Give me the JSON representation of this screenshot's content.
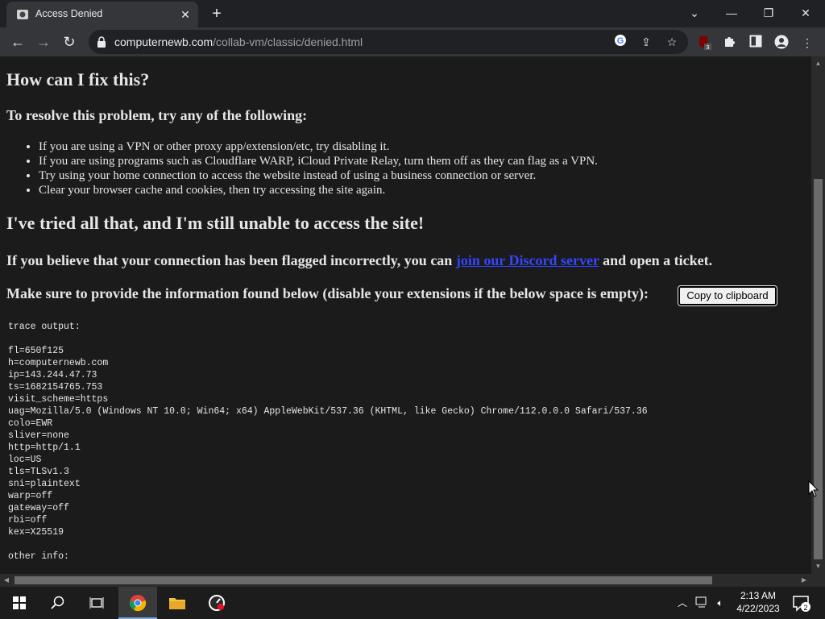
{
  "browser": {
    "tab_title": "Access Denied",
    "url_host": "computernewb.com",
    "url_path": "/collab-vm/classic/denied.html",
    "extension_badge": "3"
  },
  "page": {
    "fix_heading": "How can I fix this?",
    "resolve_heading": "To resolve this problem, try any of the following:",
    "tips": [
      "If you are using a VPN or other proxy app/extension/etc, try disabling it.",
      "If you are using programs such as Cloudflare WARP, iCloud Private Relay, turn them off as they can flag as a VPN.",
      "Try using your home connection to access the website instead of using a business connection or server.",
      "Clear your browser cache and cookies, then try accessing the site again."
    ],
    "still_heading": "I've tried all that, and I'm still unable to access the site!",
    "flagged_prefix": "If you believe that your connection has been flagged incorrectly, you can",
    "flagged_link": "join our Discord server",
    "flagged_suffix": "and open a ticket.",
    "provide_info": "Make sure to provide the information found below (disable your extensions if the below space is empty):",
    "copy_button": "Copy to clipboard",
    "trace_lines": [
      "trace output:",
      "",
      "fl=650f125",
      "h=computernewb.com",
      "ip=143.244.47.73",
      "ts=1682154765.753",
      "visit_scheme=https",
      "uag=Mozilla/5.0 (Windows NT 10.0; Win64; x64) AppleWebKit/537.36 (KHTML, like Gecko) Chrome/112.0.0.0 Safari/537.36",
      "colo=EWR",
      "sliver=none",
      "http=http/1.1",
      "loc=US",
      "tls=TLSv1.3",
      "sni=plaintext",
      "warp=off",
      "gateway=off",
      "rbi=off",
      "kex=X25519",
      "",
      "other info:"
    ]
  },
  "taskbar": {
    "time": "2:13 AM",
    "date": "4/22/2023",
    "notification_count": "2"
  },
  "colors": {
    "page_background": "#1b1b1b",
    "link": "#3345ff",
    "chrome_dark": "#202124",
    "chrome_toolbar": "#35363a"
  }
}
